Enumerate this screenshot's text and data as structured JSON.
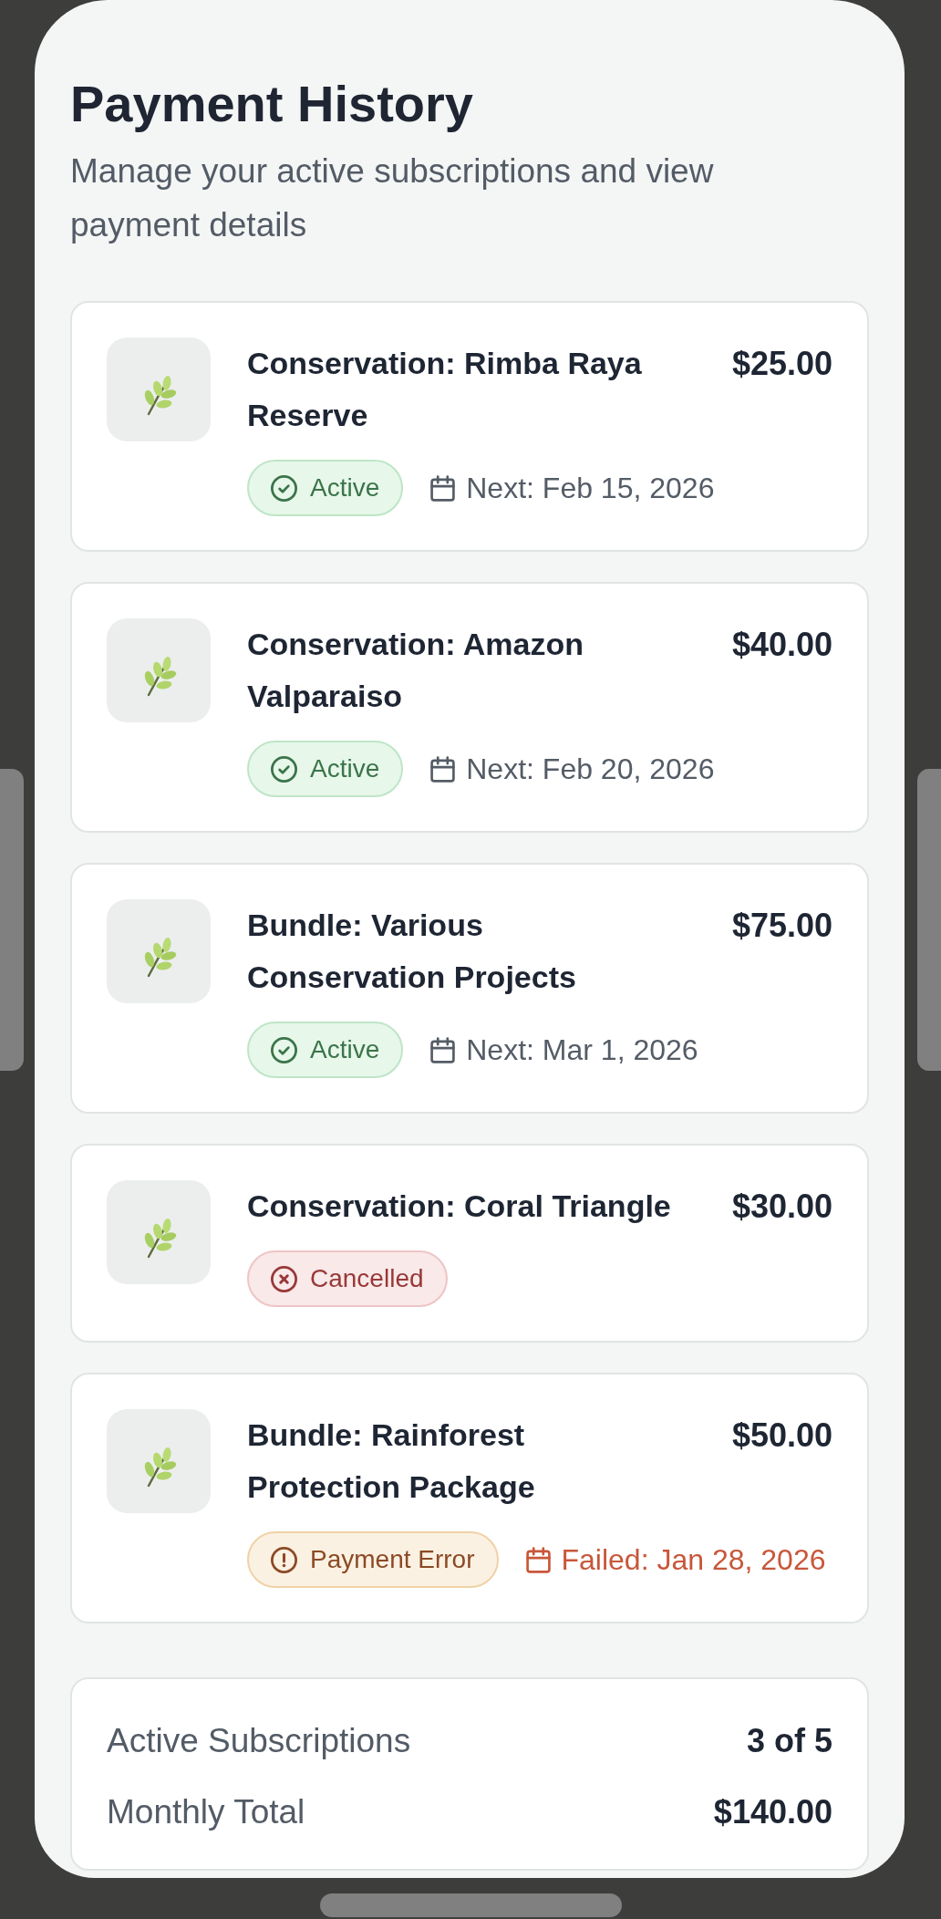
{
  "header": {
    "title": "Payment History",
    "subtitle": "Manage your active subscriptions and view payment details"
  },
  "subscriptions": [
    {
      "name": "Conservation: Rimba Raya Reserve",
      "amount": "$25.00",
      "kind": "active",
      "status": "Active",
      "date": "Next: Feb 15, 2026"
    },
    {
      "name": "Conservation: Amazon Valparaiso",
      "amount": "$40.00",
      "kind": "active",
      "status": "Active",
      "date": "Next: Feb 20, 2026"
    },
    {
      "name": "Bundle: Various Conservation Projects",
      "amount": "$75.00",
      "kind": "active",
      "status": "Active",
      "date": "Next: Mar 1, 2026"
    },
    {
      "name": "Conservation: Coral Triangle",
      "amount": "$30.00",
      "kind": "cancelled",
      "status": "Cancelled"
    },
    {
      "name": "Bundle: Rainforest Protection Package",
      "amount": "$50.00",
      "kind": "error",
      "status": "Payment Error",
      "date": "Failed: Jan 28, 2026"
    }
  ],
  "summary": [
    {
      "label": "Active Subscriptions",
      "value": "3 of 5"
    },
    {
      "label": "Monthly Total",
      "value": "$140.00"
    }
  ]
}
